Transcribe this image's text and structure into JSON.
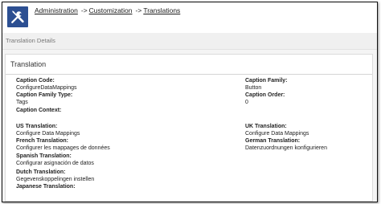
{
  "breadcrumb": {
    "items": [
      "Administration",
      "Customization",
      "Translations"
    ],
    "separator": "->"
  },
  "section_header": "Translation Details",
  "panel": {
    "title": "Translation",
    "left_fields": [
      {
        "label": "Caption Code:",
        "value": "ConfigureDataMappings"
      },
      {
        "label": "Caption Family Type:",
        "value": "Tags"
      },
      {
        "label": "Caption Context:",
        "value": ""
      },
      {
        "label": "US Translation:",
        "value": "Configure Data Mappings"
      },
      {
        "label": "French Translation:",
        "value": "Configurer les mappages de données"
      },
      {
        "label": "Spanish Translation:",
        "value": "Configurar asignación de datos"
      },
      {
        "label": "Dutch Translation:",
        "value": "Gegevenskoppelingen instellen"
      },
      {
        "label": "Japanese Translation:",
        "value": ""
      }
    ],
    "right_fields": [
      {
        "label": "Caption Family:",
        "value": "Button"
      },
      {
        "label": "Caption Order:",
        "value": "0"
      },
      {
        "label": "UK Translation:",
        "value": "Configure Data Mappings"
      },
      {
        "label": "German Translation:",
        "value": "Datenzuordnungen konfigurieren"
      }
    ]
  },
  "colors": {
    "app_icon_bg": "#2c4f92",
    "page_bg": "#f4f4f4",
    "panel_bg": "#ffffff"
  },
  "icons": {
    "app_icon": "tools-icon"
  }
}
